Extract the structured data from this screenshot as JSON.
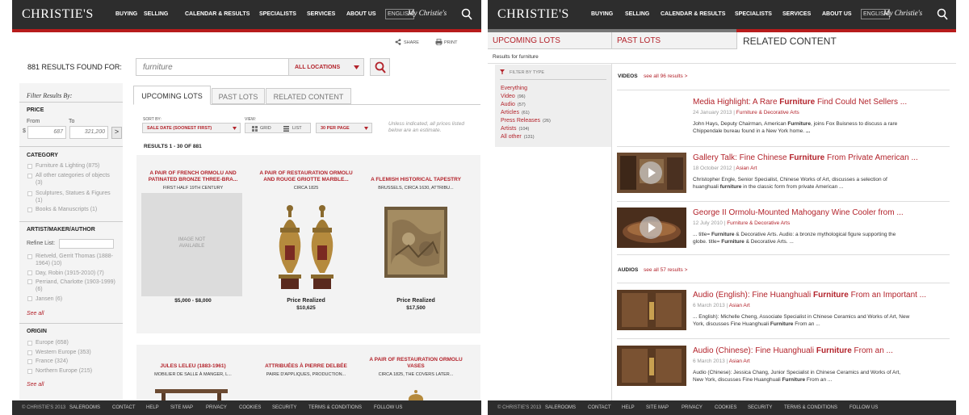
{
  "brand": {
    "logo": "CHRISTIE'S",
    "my": "My Christie's"
  },
  "nav": {
    "items": [
      "BUYING",
      "SELLING",
      "CALENDAR & RESULTS",
      "SPECIALISTS",
      "SERVICES",
      "ABOUT US"
    ],
    "language": "ENGLISH"
  },
  "footer": {
    "copyright": "© CHRISTIE'S 2013",
    "links": [
      "SALEROOMS",
      "CONTACT",
      "HELP",
      "SITE MAP",
      "PRIVACY",
      "COOKIES",
      "SECURITY",
      "TERMS & CONDITIONS",
      "FOLLOW US"
    ]
  },
  "left": {
    "share": "SHARE",
    "print": "PRINT",
    "results_count": "881 RESULTS FOUND FOR:",
    "search_value": "furniture",
    "location_select": "ALL LOCATIONS",
    "filter_title": "Filter Results By:",
    "price": {
      "label": "PRICE",
      "from_label": "From",
      "to_label": "To",
      "currency": "$",
      "from_value": "687",
      "to_value": "321,200",
      "go": ">"
    },
    "category": {
      "label": "CATEGORY",
      "items": [
        "Furniture & Lighting (875)",
        "All other categories of objects (3)",
        "Sculptures, Statues & Figures (1)",
        "Books & Manuscripts (1)"
      ]
    },
    "artist": {
      "label": "ARTIST/MAKER/AUTHOR",
      "refine": "Refine List:",
      "items": [
        "Rietveld, Gerrit Thomas (1888-1964) (10)",
        "Day, Robin (1915-2010) (7)",
        "Perriand, Charlotte (1903-1999) (6)",
        "Jansen (6)"
      ],
      "see_all": "See all"
    },
    "origin": {
      "label": "ORIGIN",
      "items": [
        "Europe (658)",
        "Western Europe (353)",
        "France (324)",
        "Northern Europe (215)"
      ],
      "see_all": "See all"
    },
    "tabs": [
      "UPCOMING LOTS",
      "PAST LOTS",
      "RELATED CONTENT"
    ],
    "sort": {
      "label": "SORT BY:",
      "value": "SALE DATE (SOONEST FIRST)"
    },
    "view": {
      "label": "VIEW:",
      "grid": "GRID",
      "list": "LIST"
    },
    "per_page": "30 PER PAGE",
    "note": "Unless indicated, all prices listed below are an estimate.",
    "results_range": "RESULTS 1 - 30 OF 881",
    "lots": [
      {
        "title": "A PAIR OF FRENCH ORMOLU AND PATINATED BRONZE THREE-BRA...",
        "sub": "FIRST HALF 19TH CENTURY",
        "image": "IMAGE NOT AVAILABLE",
        "price_label": "",
        "price": "$5,000 - $8,000"
      },
      {
        "title": "A PAIR OF RESTAURATION ORMOLU AND ROUGE GRIOTTE MARBLE...",
        "sub": "CIRCA 1825",
        "price_label": "Price Realized",
        "price": "$10,625"
      },
      {
        "title": "A FLEMISH HISTORICAL TAPESTRY",
        "sub": "BRUSSELS, CIRCA 1630, ATTRIBU...",
        "price_label": "Price Realized",
        "price": "$17,500"
      },
      {
        "title": "JULES LELEU (1883-1961)",
        "sub": "MOBILIER DE SALLE À MANGER, L..."
      },
      {
        "title": "ATTRIBUÉES À PIERRE DELBÉE",
        "sub": "PAIRE D'APPLIQUES, PRODUCTION..."
      },
      {
        "title": "A PAIR OF RESTAURATION ORMOLU VASES",
        "sub": "CIRCA 1825, THE COVERS LATER..."
      }
    ]
  },
  "right": {
    "tabs": [
      "UPCOMING LOTS",
      "PAST LOTS",
      "RELATED CONTENT"
    ],
    "results_for": "Results for  furniture",
    "filter_header": "FILTER BY TYPE",
    "types": [
      {
        "label": "Everything",
        "count": ""
      },
      {
        "label": "Video",
        "count": "(96)"
      },
      {
        "label": "Audio",
        "count": "(57)"
      },
      {
        "label": "Articles",
        "count": "(61)"
      },
      {
        "label": "Press Releases",
        "count": "(26)"
      },
      {
        "label": "Artists",
        "count": "(104)"
      },
      {
        "label": "All other",
        "count": "(131)"
      }
    ],
    "videos": {
      "label": "VIDEOS",
      "see_all": "see all 96 results >",
      "items": [
        {
          "pre": "Media Highlight: A Rare ",
          "bold": "Furniture",
          "post": " Find Could Net Sellers ...",
          "date": "24 January 2013",
          "cat": "Furniture & Decorative Arts",
          "d1a": "John Hays, Deputy Chairman, American ",
          "d1b": "Furniture",
          "d1c": ", joins Fox Buisness to discuss a rare",
          "d2a": "Chippendale bureau found in a New York home. ",
          "d2b": "...",
          "d2c": ""
        },
        {
          "pre": "Gallery Talk: Fine Chinese ",
          "bold": "Furniture",
          "post": " From Private American ...",
          "date": "18 October 2012",
          "cat": "Asian Art",
          "d1a": "Christopher Engle, Senior Specialist, Chinese Works of Art, discusses a selection of",
          "d1b": "",
          "d1c": "",
          "d2a": "huanghuali ",
          "d2b": "furniture",
          "d2c": " in the classic form from private American ..."
        },
        {
          "pre": "George II Ormolu-Mounted Mahogany Wine Cooler from ...",
          "bold": "",
          "post": "",
          "date": "12 July 2010",
          "cat": "Furniture & Decorative Arts",
          "d1a": "... title= ",
          "d1b": "Furniture",
          "d1c": " & Decorative Arts. Audio: a bronze mythological figure supporting the",
          "d2a": "globe. title= ",
          "d2b": "Furniture",
          "d2c": " & Decorative Arts. ..."
        }
      ]
    },
    "audios": {
      "label": "AUDIOS",
      "see_all": "see all 57 results >",
      "items": [
        {
          "pre": "Audio (English): Fine Huanghuali ",
          "bold": "Furniture",
          "post": " From an Important ...",
          "date": "6 March 2013",
          "cat": "Asian Art",
          "d1a": "... English): Michelle Cheng, Associate Specialist in Chinese Ceramics and Works of Art, New",
          "d1b": "",
          "d1c": "",
          "d2a": "York, discusses Fine Huanghuali ",
          "d2b": "Furniture",
          "d2c": " From an ..."
        },
        {
          "pre": "Audio (Chinese): Fine Huanghuali ",
          "bold": "Furniture",
          "post": " From an ...",
          "date": "6 March 2013",
          "cat": "Asian Art",
          "d1a": "Audio (Chinese): Jessica Chang, Junior Specialist in Chinese Ceramics and Works of Art,",
          "d1b": "",
          "d1c": "",
          "d2a": "New York, discusses Fine Huanghuali ",
          "d2b": "Furniture",
          "d2c": " From an ..."
        }
      ]
    }
  }
}
